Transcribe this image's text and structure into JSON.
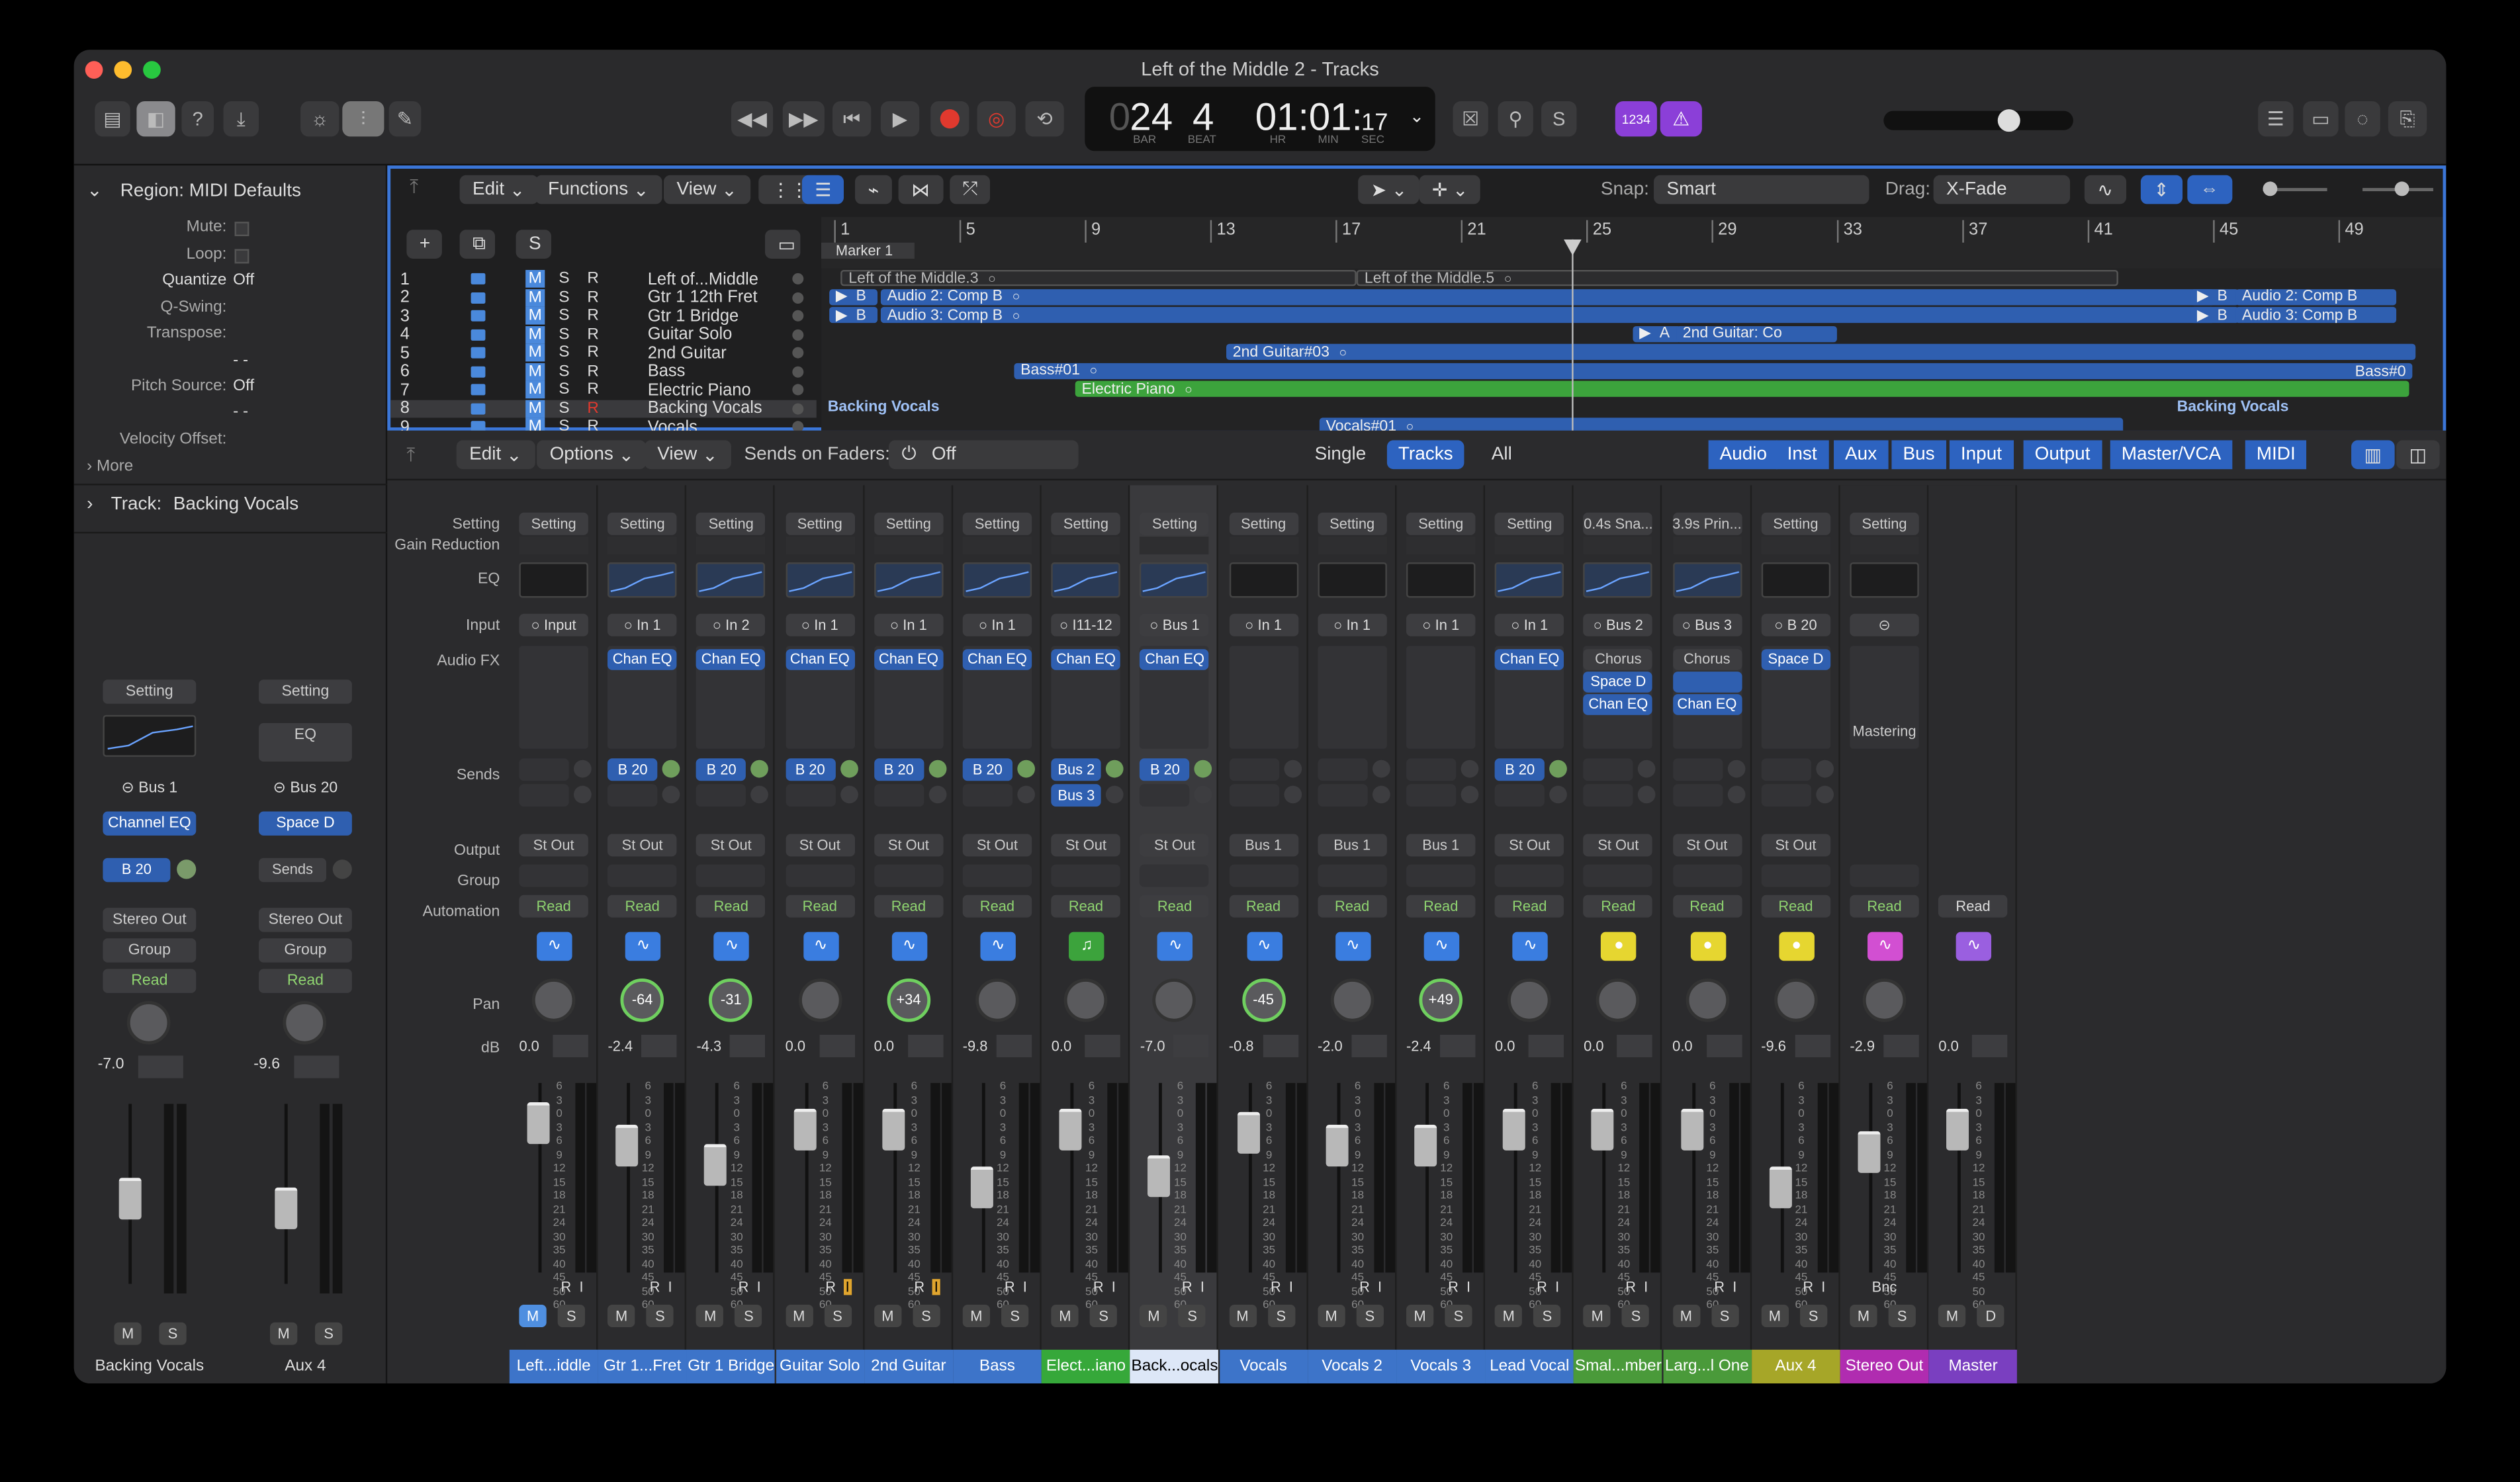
{
  "window": {
    "title": "Left of the Middle 2 - Tracks"
  },
  "lcd": {
    "bar_prefix": "0",
    "bar": "24",
    "beat": "4",
    "bar_label": "BAR",
    "beat_label": "BEAT",
    "time": "01:01:",
    "frames": "17",
    "hr": "HR",
    "min": "MIN",
    "sec": "SEC"
  },
  "count_in": "1234",
  "inspector": {
    "region_title": "Region: MIDI Defaults",
    "rows": [
      {
        "label": "Mute:",
        "value": ""
      },
      {
        "label": "Loop:",
        "value": ""
      },
      {
        "label": "Quantize",
        "value": "Off"
      },
      {
        "label": "Q-Swing:",
        "value": ""
      },
      {
        "label": "Transpose:",
        "value": ""
      },
      {
        "label": "",
        "value": "- -"
      },
      {
        "label": "Pitch Source:",
        "value": "Off"
      },
      {
        "label": "",
        "value": "- -"
      },
      {
        "label": "Velocity Offset:",
        "value": ""
      }
    ],
    "more": "More",
    "track_title": "Track:",
    "track_name": "Backing Vocals",
    "strips": [
      {
        "setting": "Setting",
        "input": "Bus 1",
        "fx": "Channel EQ",
        "send": "B 20",
        "output": "Stereo Out",
        "group": "Group",
        "auto": "Read",
        "db": "-7.0",
        "name": "Backing Vocals"
      },
      {
        "setting": "Setting",
        "eq": "EQ",
        "input": "Bus 20",
        "fx": "Space D",
        "send": "Sends",
        "output": "Stereo Out",
        "group": "Group",
        "auto": "Read",
        "db": "-9.6",
        "name": "Aux 4"
      }
    ]
  },
  "arrange": {
    "menus": [
      "Edit",
      "Functions",
      "View"
    ],
    "snap_label": "Snap:",
    "snap": "Smart",
    "drag_label": "Drag:",
    "drag": "X-Fade",
    "s_button": "S",
    "ruler": [
      "1",
      "5",
      "9",
      "13",
      "17",
      "21",
      "25",
      "29",
      "33",
      "37",
      "41",
      "45",
      "49"
    ],
    "marker": "Marker 1",
    "tracks": [
      {
        "n": "1",
        "name": "Left of...Middle"
      },
      {
        "n": "2",
        "name": "Gtr 1 12th Fret"
      },
      {
        "n": "3",
        "name": "Gtr 1 Bridge"
      },
      {
        "n": "4",
        "name": "Guitar Solo"
      },
      {
        "n": "5",
        "name": "2nd Guitar"
      },
      {
        "n": "6",
        "name": "Bass"
      },
      {
        "n": "7",
        "name": "Electric Piano"
      },
      {
        "n": "8",
        "name": "Backing Vocals"
      },
      {
        "n": "9",
        "name": "Vocals"
      }
    ],
    "msr": [
      "M",
      "S",
      "R"
    ],
    "regions": {
      "r1a": "Left of the Middle.3",
      "r1b": "Left of the Middle.5",
      "r2a": "B",
      "r2b": "Audio 2: Comp B",
      "r2c": "Audio 2: Comp B",
      "r3a": "B",
      "r3b": "Audio 3: Comp B",
      "r3c": "Audio 3: Comp B",
      "r4a": "A",
      "r4": "2nd Guitar: Co",
      "r5": "2nd Guitar#03",
      "r6a": "Bass#01",
      "r6b": "Bass#0",
      "r7": "Electric Piano",
      "r8a": "Backing Vocals",
      "r8b": "Backing Vocals",
      "r9": "Vocals#01"
    }
  },
  "mixer": {
    "menus": [
      "Edit",
      "Options",
      "View"
    ],
    "sends_on_faders": "Sends on Faders:",
    "sends_value": "Off",
    "views": [
      "Single",
      "Tracks",
      "All"
    ],
    "filters": [
      "Audio",
      "Inst",
      "Aux",
      "Bus",
      "Input",
      "Output",
      "Master/VCA",
      "MIDI"
    ],
    "row_labels": {
      "setting": "Setting",
      "gain": "Gain Reduction",
      "eq": "EQ",
      "input": "Input",
      "fx": "Audio FX",
      "sends": "Sends",
      "output": "Output",
      "group": "Group",
      "automation": "Automation",
      "pan": "Pan",
      "db": "dB"
    },
    "strips": [
      {
        "setting": "Setting",
        "input": "Input",
        "fx": [],
        "send": "",
        "output": "St Out",
        "auto": "Read",
        "pan": "",
        "db": "0.0",
        "name": "Left...iddle",
        "color": "#3d74c9"
      },
      {
        "setting": "Setting",
        "input": "In 1",
        "fx": [
          "Chan EQ"
        ],
        "send": "B 20",
        "output": "St Out",
        "auto": "Read",
        "pan": "-64",
        "db": "-2.4",
        "name": "Gtr 1...Fret",
        "color": "#3d74c9"
      },
      {
        "setting": "Setting",
        "input": "In 2",
        "fx": [
          "Chan EQ"
        ],
        "send": "B 20",
        "output": "St Out",
        "auto": "Read",
        "pan": "-31",
        "db": "-4.3",
        "name": "Gtr 1 Bridge",
        "color": "#3d74c9"
      },
      {
        "setting": "Setting",
        "input": "In 1",
        "fx": [
          "Chan EQ"
        ],
        "send": "B 20",
        "output": "St Out",
        "auto": "Read",
        "pan": "",
        "db": "0.0",
        "name": "Guitar Solo",
        "color": "#3d74c9"
      },
      {
        "setting": "Setting",
        "input": "In 1",
        "fx": [
          "Chan EQ"
        ],
        "send": "B 20",
        "output": "St Out",
        "auto": "Read",
        "pan": "+34",
        "db": "0.0",
        "name": "2nd Guitar",
        "color": "#3d74c9"
      },
      {
        "setting": "Setting",
        "input": "In 1",
        "fx": [
          "Chan EQ"
        ],
        "send": "B 20",
        "output": "St Out",
        "auto": "Read",
        "pan": "",
        "db": "-9.8",
        "name": "Bass",
        "color": "#3d74c9"
      },
      {
        "setting": "Setting",
        "input": "I11-12",
        "fx": [
          "Chan EQ"
        ],
        "send": "Bus 2",
        "send2": "Bus 3",
        "output": "St Out",
        "auto": "Read",
        "pan": "",
        "db": "0.0",
        "name": "Elect...iano",
        "color": "#36a83a"
      },
      {
        "setting": "Setting",
        "input": "Bus 1",
        "fx": [
          "Chan EQ"
        ],
        "send": "B 20",
        "output": "St Out",
        "auto": "Read",
        "pan": "",
        "db": "-7.0",
        "name": "Back...ocals",
        "color": "#dde7f7"
      },
      {
        "setting": "Setting",
        "input": "In 1",
        "fx": [],
        "send": "",
        "output": "Bus 1",
        "auto": "Read",
        "pan": "-45",
        "db": "-0.8",
        "name": "Vocals",
        "color": "#3d74c9"
      },
      {
        "setting": "Setting",
        "input": "In 1",
        "fx": [],
        "send": "",
        "output": "Bus 1",
        "auto": "Read",
        "pan": "",
        "db": "-2.0",
        "name": "Vocals 2",
        "color": "#3d74c9"
      },
      {
        "setting": "Setting",
        "input": "In 1",
        "fx": [],
        "send": "",
        "output": "Bus 1",
        "auto": "Read",
        "pan": "+49",
        "db": "-2.4",
        "name": "Vocals 3",
        "color": "#3d74c9"
      },
      {
        "setting": "Setting",
        "input": "In 1",
        "fx": [
          "Chan EQ"
        ],
        "send": "B 20",
        "output": "St Out",
        "auto": "Read",
        "pan": "",
        "db": "0.0",
        "name": "Lead Vocal",
        "color": "#3d74c9"
      },
      {
        "setting": "0.4s Sna...",
        "input": "Bus 2",
        "fx": [
          "Chorus",
          "Space D",
          "Chan EQ"
        ],
        "send": "",
        "output": "St Out",
        "auto": "Read",
        "pan": "",
        "db": "0.0",
        "name": "Smal...mber",
        "color": "#4a9a3a"
      },
      {
        "setting": "3.9s Prin...",
        "input": "Bus 3",
        "fx": [
          "Chorus",
          "",
          "Chan EQ"
        ],
        "send": "",
        "output": "St Out",
        "auto": "Read",
        "pan": "",
        "db": "0.0",
        "name": "Larg...l One",
        "color": "#4a9a3a"
      },
      {
        "setting": "Setting",
        "input": "B 20",
        "fx": [
          "Space D"
        ],
        "send": "",
        "output": "St Out",
        "auto": "Read",
        "pan": "",
        "db": "-9.6",
        "name": "Aux 4",
        "color": "#a6a628"
      },
      {
        "setting": "Setting",
        "input": "",
        "fx": [],
        "mastering": "Mastering",
        "send": "",
        "output": "",
        "auto": "Read",
        "pan": "",
        "db": "-2.9",
        "name": "Stereo Out",
        "color": "#b02cb0",
        "bnc": "Bnc"
      },
      {
        "setting": "",
        "input": "",
        "fx": [],
        "send": "",
        "output": "",
        "auto": "Read",
        "pan": "",
        "db": "0.0",
        "name": "Master",
        "color": "#7a3fc0"
      }
    ],
    "ms": [
      "M",
      "S"
    ],
    "ri": [
      "R",
      "I"
    ],
    "d": "D",
    "scale": [
      "6",
      "3",
      "0",
      "3",
      "6",
      "9",
      "12",
      "15",
      "18",
      "21",
      "24",
      "30",
      "35",
      "40",
      "45",
      "50",
      "60"
    ],
    "scale_right": [
      "0",
      "3",
      "6",
      "9",
      "12",
      "15",
      "18",
      "21",
      "24",
      "30",
      "35",
      "40",
      "45",
      "50",
      "60"
    ]
  },
  "colors": {
    "accent": "#3b76d8",
    "record": "#e0392e",
    "selected_strip": "#3a3a3d"
  }
}
